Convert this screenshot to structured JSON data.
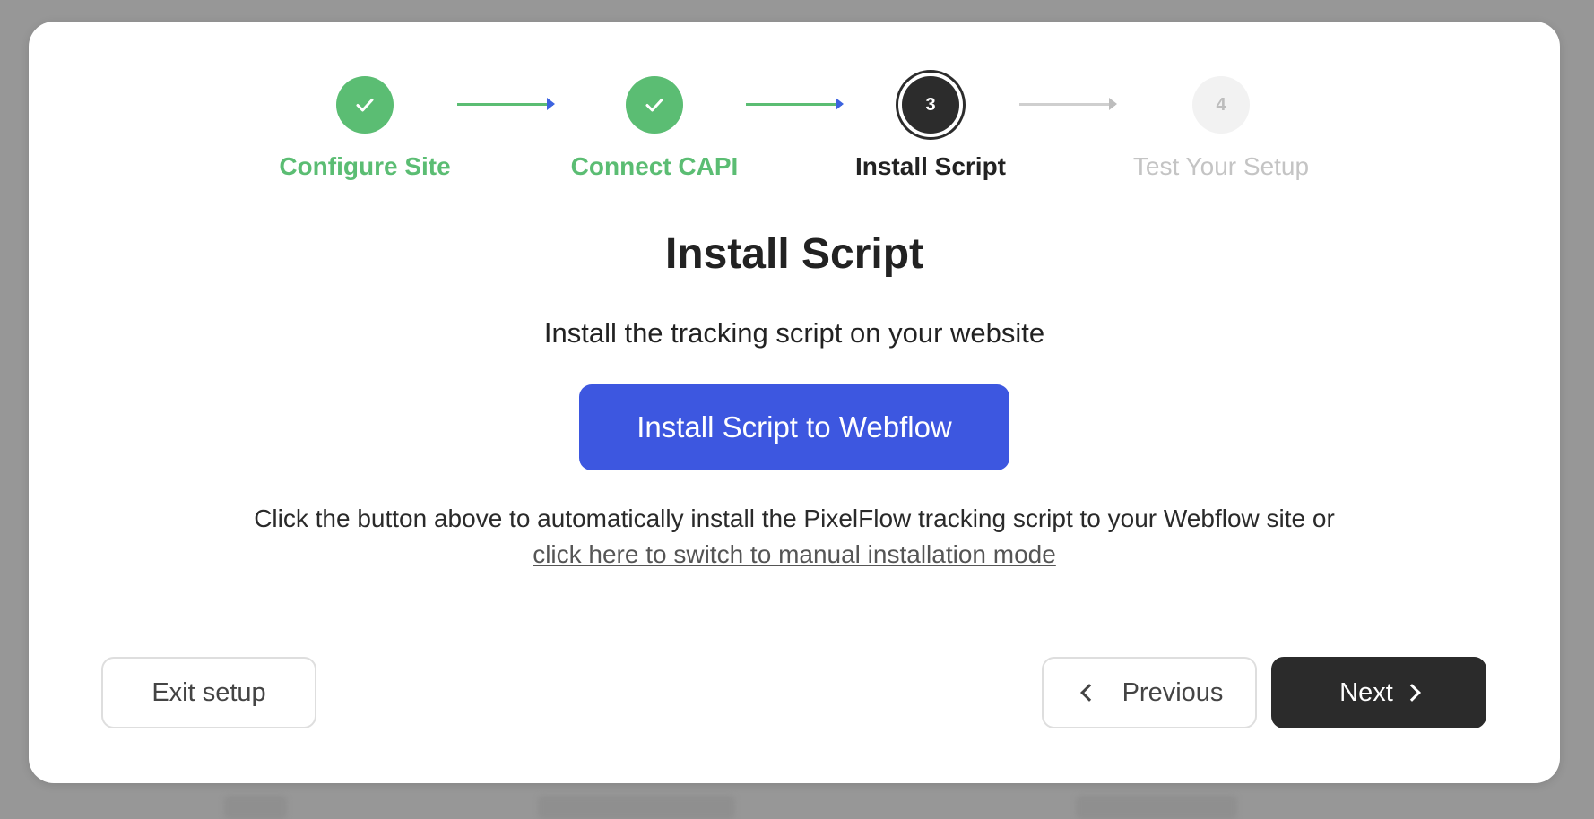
{
  "stepper": {
    "steps": [
      {
        "label": "Configure Site",
        "state": "done",
        "number": ""
      },
      {
        "label": "Connect CAPI",
        "state": "done",
        "number": ""
      },
      {
        "label": "Install Script",
        "state": "current",
        "number": "3"
      },
      {
        "label": "Test Your Setup",
        "state": "future",
        "number": "4"
      }
    ]
  },
  "content": {
    "title": "Install Script",
    "subtitle": "Install the tracking script on your website",
    "primary_button": "Install Script to Webflow",
    "help_text": "Click the button above to automatically install the PixelFlow tracking script to your Webflow site or",
    "manual_link": "click here to switch to manual installation mode"
  },
  "footer": {
    "exit_label": "Exit setup",
    "previous_label": "Previous",
    "next_label": "Next"
  },
  "colors": {
    "success": "#5bbd73",
    "accent": "#3d57e0",
    "dark": "#2b2b2b",
    "muted": "#c4c4c4"
  }
}
